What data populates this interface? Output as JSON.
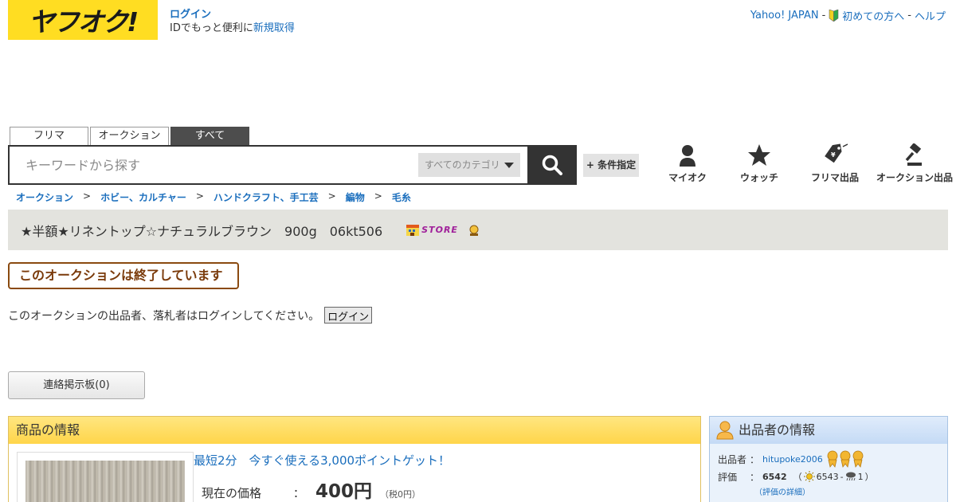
{
  "logo": {
    "text": "ヤフオク!"
  },
  "login": {
    "link": "ログイン",
    "line2_prefix": "IDでもっと便利に",
    "signup": "新規取得"
  },
  "top_links": {
    "yahoo": "Yahoo! JAPAN",
    "sep1": "-",
    "beginner": "初めての方へ",
    "sep2": "-",
    "help": "ヘルプ"
  },
  "tabs": [
    {
      "label": "フリマ",
      "active": false
    },
    {
      "label": "オークション",
      "active": false
    },
    {
      "label": "すべて",
      "active": true
    }
  ],
  "search": {
    "placeholder": "キーワードから探す",
    "category": "すべてのカテゴリ"
  },
  "cond_button": "+ 条件指定",
  "nav": {
    "myauc": "マイオク",
    "watch": "ウォッチ",
    "flea_sell": "フリマ出品",
    "auction_sell": "オークション出品"
  },
  "breadcrumb": {
    "items": [
      "オークション",
      "ホビー、カルチャー",
      "ハンドクラフト、手工芸",
      "編物",
      "毛糸"
    ],
    "sep": ">"
  },
  "item": {
    "title": "★半額★リネントップ☆ナチュラルブラウン　900g　06kt506",
    "store_label": "STORE"
  },
  "ended": "このオークションは終了しています",
  "notice": {
    "text": "このオークションの出品者、落札者はログインしてください。",
    "button": "ログイン"
  },
  "board_button": "連絡掲示板(0)",
  "product": {
    "heading": "商品の情報",
    "promo": "最短2分　今すぐ使える3,000ポイントゲット！",
    "price_label": "現在の価格",
    "colon": "：",
    "price": "400円",
    "tax": "（税0円）"
  },
  "seller": {
    "heading": "出品者の情報",
    "label_seller": "出品者",
    "label_rating": "評価",
    "colon": "：",
    "name": "hitupoke2006",
    "score": "6542",
    "open": "（",
    "good": "6543",
    "dash": "-",
    "bad": "1",
    "close": "）",
    "detail_link": "（評価の詳細）"
  },
  "colors": {
    "brand_yellow": "#ffdd22",
    "link_blue": "#1a6ebd",
    "ended_brown": "#7a3a0a"
  }
}
